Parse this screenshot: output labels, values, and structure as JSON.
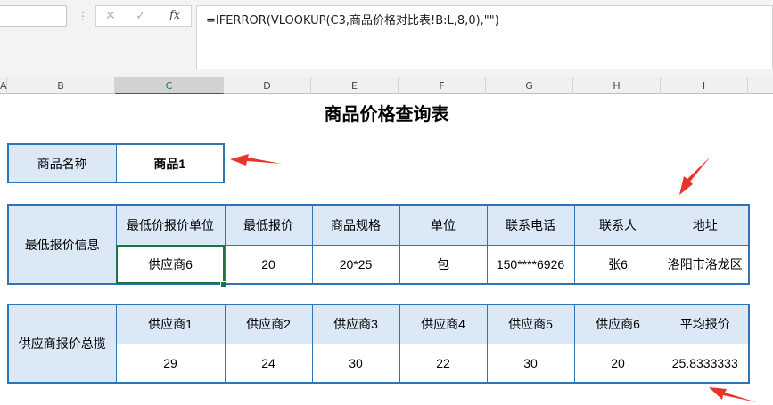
{
  "formula_bar": {
    "name_box_value": "",
    "cancel_icon": "✕",
    "enter_icon": "✓",
    "fx_label": "fx",
    "formula": "=IFERROR(VLOOKUP(C3,商品价格对比表!B:L,8,0),\"\")"
  },
  "columns": [
    {
      "label": "A",
      "active": false
    },
    {
      "label": "B",
      "active": false
    },
    {
      "label": "C",
      "active": true
    },
    {
      "label": "D",
      "active": false
    },
    {
      "label": "E",
      "active": false
    },
    {
      "label": "F",
      "active": false
    },
    {
      "label": "G",
      "active": false
    },
    {
      "label": "H",
      "active": false
    },
    {
      "label": "I",
      "active": false
    }
  ],
  "sheet": {
    "title": "商品价格查询表",
    "product": {
      "label": "商品名称",
      "value": "商品1"
    },
    "lowest": {
      "label": "最低报价信息",
      "headers": [
        "最低价报价单位",
        "最低报价",
        "商品规格",
        "单位",
        "联系电话",
        "联系人",
        "地址"
      ],
      "values": [
        "供应商6",
        "20",
        "20*25",
        "包",
        "150****6926",
        "张6",
        "洛阳市洛龙区"
      ]
    },
    "summary": {
      "label": "供应商报价总揽",
      "headers": [
        "供应商1",
        "供应商2",
        "供应商3",
        "供应商4",
        "供应商5",
        "供应商6",
        "平均报价"
      ],
      "values": [
        "29",
        "24",
        "30",
        "22",
        "30",
        "20",
        "25.8333333"
      ]
    }
  },
  "colors": {
    "accent_border": "#2e75b6",
    "label_fill": "#dbe8f6",
    "selection": "#217346",
    "arrow": "#e8352a"
  }
}
